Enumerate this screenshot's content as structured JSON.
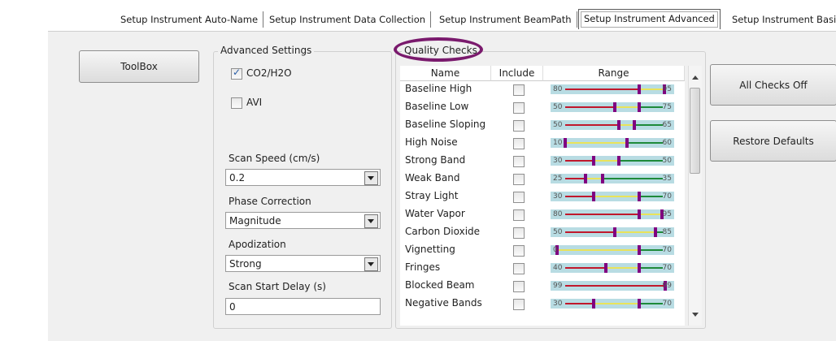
{
  "tabs": [
    {
      "label": "Setup Instrument Auto-Name"
    },
    {
      "label": "Setup Instrument Data Collection"
    },
    {
      "label": "Setup Instrument BeamPath"
    },
    {
      "label": "Setup Instrument Advanced"
    },
    {
      "label": "Setup Instrument Basic"
    }
  ],
  "toolbox_label": "ToolBox",
  "advanced": {
    "title": "Advanced Settings",
    "co2_label": "CO2/H2O",
    "co2_checked": true,
    "avi_label": "AVI",
    "avi_checked": false,
    "scan_speed_label": "Scan Speed (cm/s)",
    "scan_speed_value": "0.2",
    "phase_label": "Phase Correction",
    "phase_value": "Magnitude",
    "apod_label": "Apodization",
    "apod_value": "Strong",
    "delay_label": "Scan Start Delay (s)",
    "delay_value": "0"
  },
  "quality": {
    "title": "Quality Checks",
    "headers": {
      "name": "Name",
      "include": "Include",
      "range": "Range"
    },
    "rows": [
      {
        "name": "Baseline High",
        "min": "80",
        "max": "95"
      },
      {
        "name": "Baseline Low",
        "min": "50",
        "max": "75"
      },
      {
        "name": "Baseline Sloping",
        "min": "50",
        "max": "65"
      },
      {
        "name": "High Noise",
        "min": "10",
        "max": "60"
      },
      {
        "name": "Strong Band",
        "min": "30",
        "max": "50"
      },
      {
        "name": "Weak Band",
        "min": "25",
        "max": "35"
      },
      {
        "name": "Stray Light",
        "min": "30",
        "max": "70"
      },
      {
        "name": "Water Vapor",
        "min": "80",
        "max": "95"
      },
      {
        "name": "Carbon Dioxide",
        "min": "50",
        "max": "85"
      },
      {
        "name": "Vignetting",
        "min": "0",
        "max": "70"
      },
      {
        "name": "Fringes",
        "min": "40",
        "max": "70"
      },
      {
        "name": "Blocked Beam",
        "min": "99",
        "max": "99"
      },
      {
        "name": "Negative Bands",
        "min": "30",
        "max": "70"
      }
    ]
  },
  "all_checks_off_label": "All Checks Off",
  "restore_defaults_label": "Restore Defaults"
}
